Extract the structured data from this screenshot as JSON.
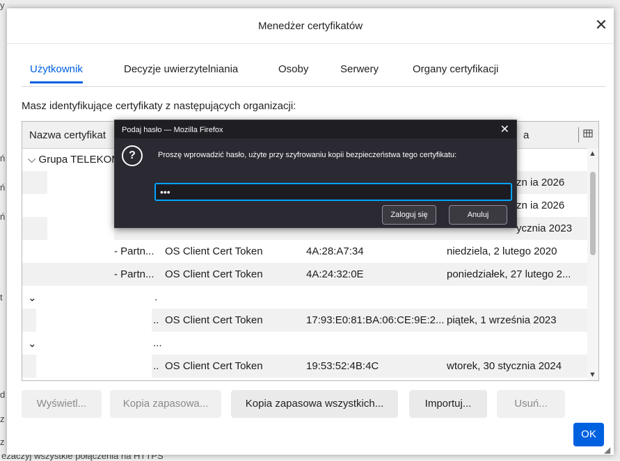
{
  "background": {
    "bg_fragments": [
      "y",
      "ń",
      "ń",
      "ń",
      "t",
      "d",
      "z",
      "z",
      "ezaczyj wszystkie połączenia na HTTPS"
    ]
  },
  "dialog": {
    "title": "Menedżer certyfikatów",
    "close_glyph": "✕"
  },
  "tabs": [
    {
      "label": "Użytkownik",
      "active": true
    },
    {
      "label": "Decyzje uwierzytelniania",
      "active": false
    },
    {
      "label": "Osoby",
      "active": false
    },
    {
      "label": "Serwery",
      "active": false
    },
    {
      "label": "Organy certyfikacji",
      "active": false
    }
  ],
  "description": "Masz identyfikujące certyfikaty z następujących organizacji:",
  "table": {
    "headers": [
      "Nazwa certyfikat",
      "a"
    ],
    "column_picker_icon": "column-picker-icon",
    "rows": [
      {
        "name": "⌵ Grupa TELEKOM",
        "device": "",
        "serial": "",
        "expires": ""
      },
      {
        "name": "",
        "device": "",
        "serial": "",
        "expires": "zn ia 2026"
      },
      {
        "name": "",
        "device": "",
        "serial": "",
        "expires": "zn ia 2026"
      },
      {
        "name": "",
        "device": "",
        "serial": "",
        "expires": "ycznia 2023"
      },
      {
        "name": "- Partn...",
        "device": "OS Client Cert Token",
        "serial": "4A:28:A7:34",
        "expires": "niedziela, 2 lutego 2020"
      },
      {
        "name": "- Partn...",
        "device": "OS Client Cert Token",
        "serial": "4A:24:32:0E",
        "expires": "poniedziałek, 27 lutego 2..."
      },
      {
        "name": ".",
        "device": "",
        "serial": "",
        "expires": ""
      },
      {
        "name": "..",
        "device": "OS Client Cert Token",
        "serial": "17:93:E0:81:BA:06:CE:9E:2...",
        "expires": "piątek, 1 września 2023"
      },
      {
        "name": "...",
        "device": "",
        "serial": "",
        "expires": ""
      },
      {
        "name": "..",
        "device": "OS Client Cert Token",
        "serial": "19:53:52:4B:4C",
        "expires": "wtorek, 30 stycznia 2024"
      }
    ]
  },
  "buttons": {
    "view": "Wyświetl...",
    "backup": "Kopia zapasowa...",
    "backup_all": "Kopia zapasowa wszystkich...",
    "import": "Importuj...",
    "delete": "Usuń...",
    "ok": "OK"
  },
  "password_prompt": {
    "title": "Podaj hasło — Mozilla Firefox",
    "close_glyph": "✕",
    "message": "Proszę wprowadzić hasło, użyte przy szyfrowaniu kopii bezpieczeństwa tego certyfikatu:",
    "input_value": "•••",
    "login_label": "Zaloguj się",
    "cancel_label": "Anuluj"
  },
  "colors": {
    "accent": "#0061e0",
    "prompt_bg": "#2b2a33",
    "prompt_focus": "#00a4ff"
  }
}
